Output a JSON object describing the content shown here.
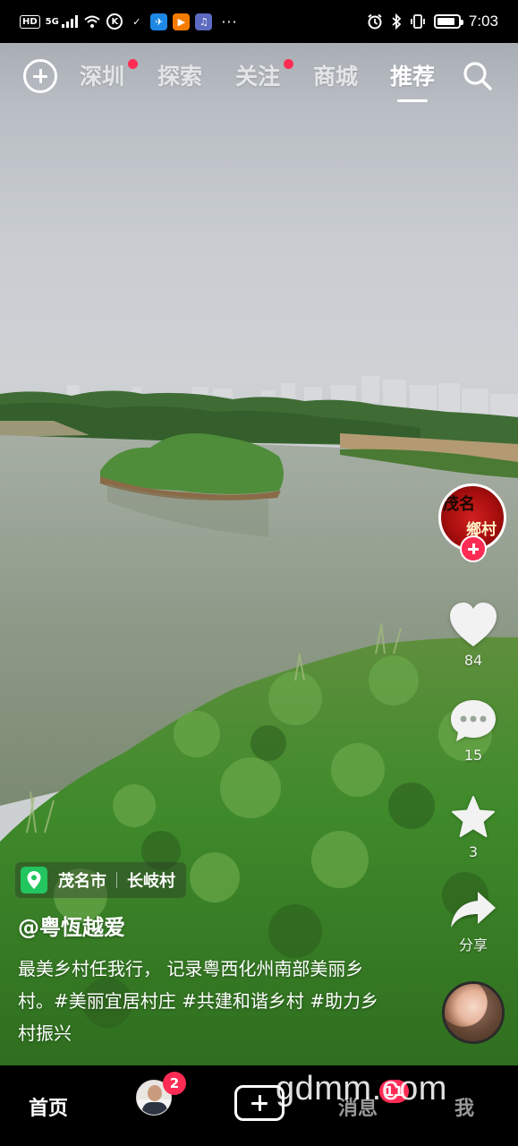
{
  "status_bar": {
    "network_label": "HD",
    "signal_label": "5G",
    "app_icons": [
      {
        "name": "k-app-icon",
        "glyph": "K",
        "color": "#000000"
      },
      {
        "name": "check-app-icon",
        "glyph": "✓",
        "color": "#000000"
      },
      {
        "name": "blue-app-icon",
        "glyph": "✈",
        "color": "#1e88e5"
      },
      {
        "name": "orange-app-icon",
        "glyph": "▶",
        "color": "#f57c00"
      },
      {
        "name": "music-app-icon",
        "glyph": "♫",
        "color": "#5c6bc0"
      }
    ],
    "more_label": "···",
    "battery_level": 0.85,
    "time": "7:03"
  },
  "top_nav": {
    "tabs": [
      {
        "label": "深圳",
        "has_dot": true
      },
      {
        "label": "探索",
        "has_dot": false
      },
      {
        "label": "关注",
        "has_dot": true
      },
      {
        "label": "商城",
        "has_dot": false
      },
      {
        "label": "推荐",
        "has_dot": false,
        "active": true
      }
    ]
  },
  "creator": {
    "avatar_text_1": "茂名",
    "avatar_text_2": "鄉村"
  },
  "actions": {
    "likes": "84",
    "comments": "15",
    "favorites": "3",
    "share_label": "分享"
  },
  "video": {
    "location_city": "茂名市",
    "location_village": "长岐村",
    "author": "@粤恆越爱",
    "caption": "最美乡村任我行， 记录粤西化州南部美丽乡村。#美丽宜居村庄 #共建和谐乡村 #助力乡村振兴"
  },
  "bottom_tabs": {
    "home": "首页",
    "friends_badge": "2",
    "messages": "消息",
    "messages_badge": "11",
    "me": "我"
  },
  "watermark": "gdmm.com",
  "colors": {
    "accent": "#fe2c55",
    "location_green": "#22c55e"
  }
}
